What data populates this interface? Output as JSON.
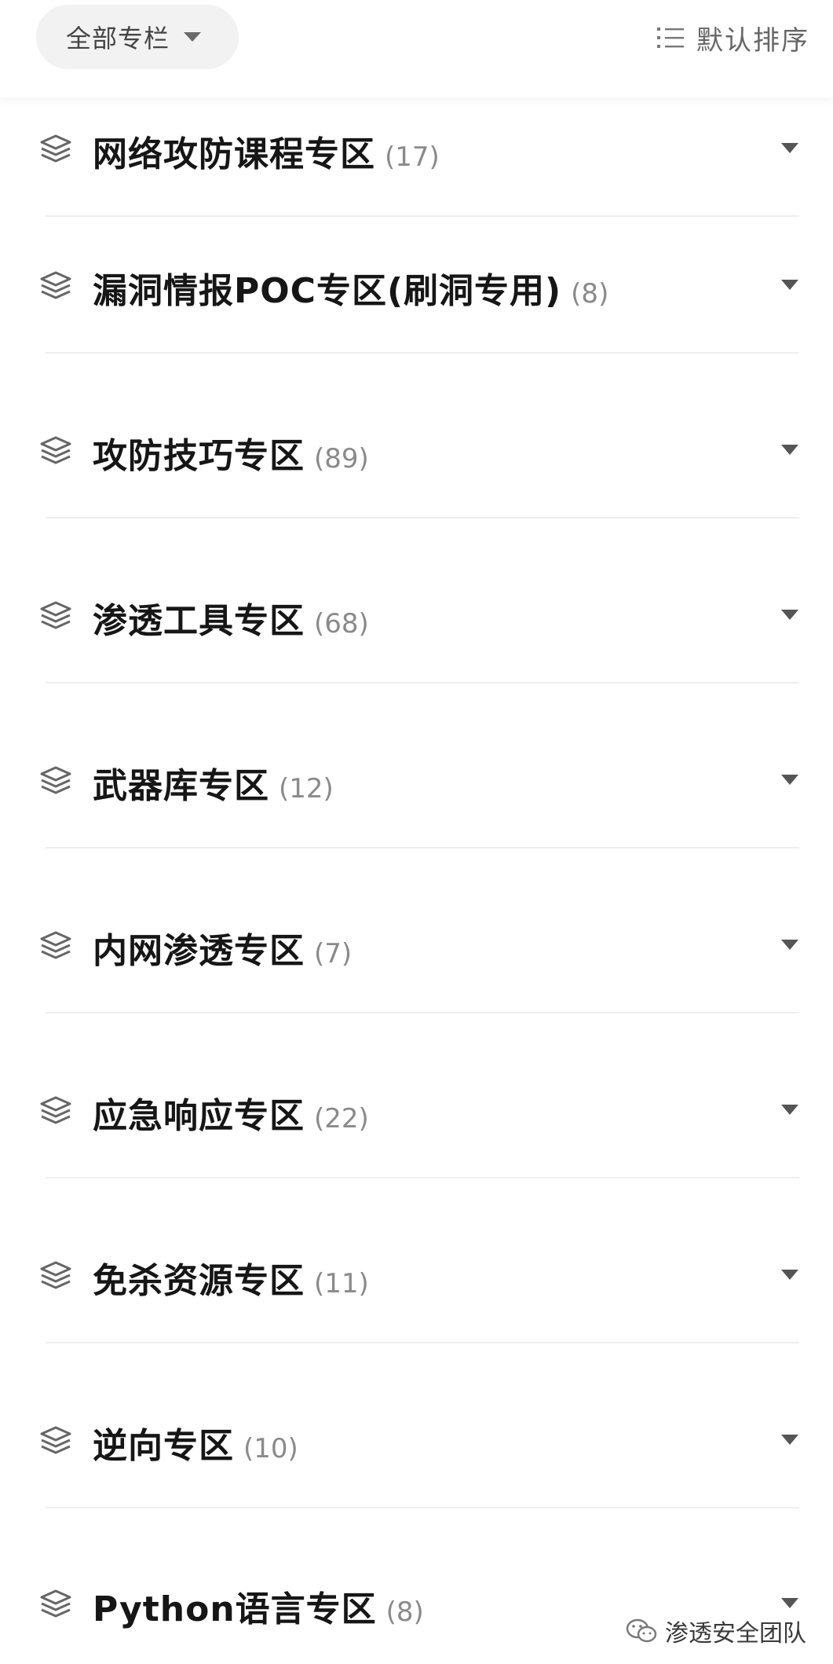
{
  "header": {
    "filter_label": "全部专栏",
    "sort_label": "默认排序"
  },
  "categories": [
    {
      "title": "网络攻防课程专区",
      "count": "(17)"
    },
    {
      "title": "漏洞情报POC专区(刷洞专用)",
      "count": "(8)"
    },
    {
      "title": "攻防技巧专区",
      "count": "(89)"
    },
    {
      "title": "渗透工具专区",
      "count": "(68)"
    },
    {
      "title": "武器库专区",
      "count": "(12)"
    },
    {
      "title": "内网渗透专区",
      "count": "(7)"
    },
    {
      "title": "应急响应专区",
      "count": "(22)"
    },
    {
      "title": "免杀资源专区",
      "count": "(11)"
    },
    {
      "title": "逆向专区",
      "count": "(10)"
    },
    {
      "title": "Python语言专区",
      "count": "(8)"
    }
  ],
  "icons": {
    "row_icon": "layers-icon",
    "row_expand": "chevron-down-icon",
    "sort_icon": "list-icon",
    "watermark_icon": "wechat-icon"
  },
  "watermark": {
    "text": "渗透安全团队"
  },
  "colors": {
    "pill_bg": "#f2f2f2",
    "title": "#161616",
    "count": "#8a8a8a",
    "divider": "#efefef"
  }
}
